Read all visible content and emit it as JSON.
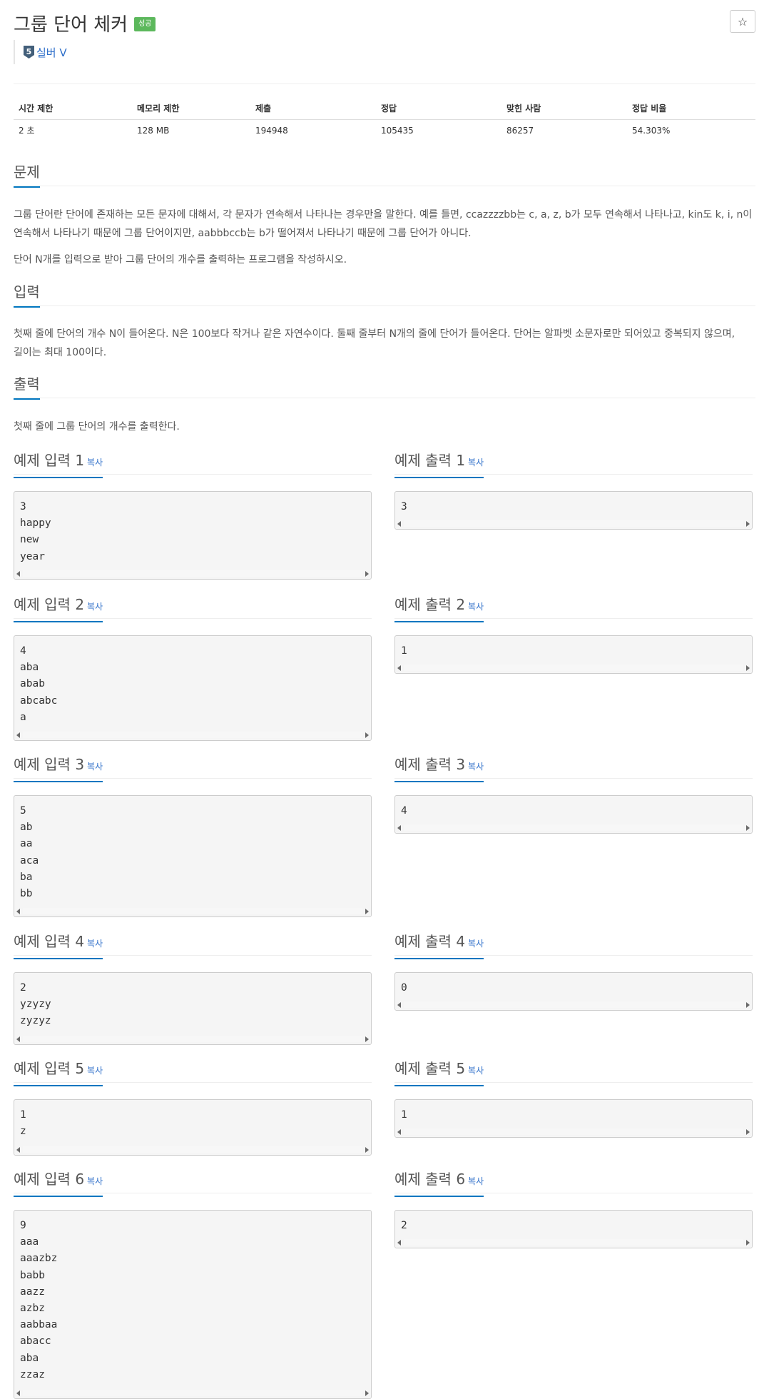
{
  "header": {
    "title": "그룹 단어 체커",
    "badge": "성공",
    "star_icon": "☆",
    "tier_level": "5",
    "tier_label": "실버 V"
  },
  "stats": {
    "headers": [
      "시간 제한",
      "메모리 제한",
      "제출",
      "정답",
      "맞힌 사람",
      "정답 비율"
    ],
    "values": [
      "2 초",
      "128 MB",
      "194948",
      "105435",
      "86257",
      "54.303%"
    ]
  },
  "problem": {
    "title": "문제",
    "p1_line1": "그룹 단어란 단어에 존재하는 모든 문자에 대해서, 각 문자가 연속해서 나타나는 경우만을 말한다. 예를 들면, ccazzzzbb는 c, a, z, b가 모두 연속해서 나타나고, kin도 k, i, n이",
    "p1_line2": "연속해서 나타나기 때문에 그룹 단어이지만, aabbbccb는 b가 떨어져서 나타나기 때문에 그룹 단어가 아니다.",
    "p2": "단어 N개를 입력으로 받아 그룹 단어의 개수를 출력하는 프로그램을 작성하시오."
  },
  "input": {
    "title": "입력",
    "line1": "첫째 줄에 단어의 개수 N이 들어온다. N은 100보다 작거나 같은 자연수이다. 둘째 줄부터 N개의 줄에 단어가 들어온다. 단어는 알파벳 소문자로만 되어있고 중복되지 않으며,",
    "line2": "길이는 최대 100이다."
  },
  "output": {
    "title": "출력",
    "text": "첫째 줄에 그룹 단어의 개수를 출력한다."
  },
  "copy_label": "복사",
  "examples": [
    {
      "in_title": "예제 입력 1",
      "out_title": "예제 출력 1",
      "input": "3\nhappy\nnew\nyear",
      "output": "3"
    },
    {
      "in_title": "예제 입력 2",
      "out_title": "예제 출력 2",
      "input": "4\naba\nabab\nabcabc\na",
      "output": "1"
    },
    {
      "in_title": "예제 입력 3",
      "out_title": "예제 출력 3",
      "input": "5\nab\naa\naca\nba\nbb",
      "output": "4"
    },
    {
      "in_title": "예제 입력 4",
      "out_title": "예제 출력 4",
      "input": "2\nyzyzy\nzyzyz",
      "output": "0"
    },
    {
      "in_title": "예제 입력 5",
      "out_title": "예제 출력 5",
      "input": "1\nz",
      "output": "1"
    },
    {
      "in_title": "예제 입력 6",
      "out_title": "예제 출력 6",
      "input": "9\naaa\naaazbz\nbabb\naazz\nazbz\naabbaa\nabacc\naba\nzzaz",
      "output": "2"
    }
  ]
}
